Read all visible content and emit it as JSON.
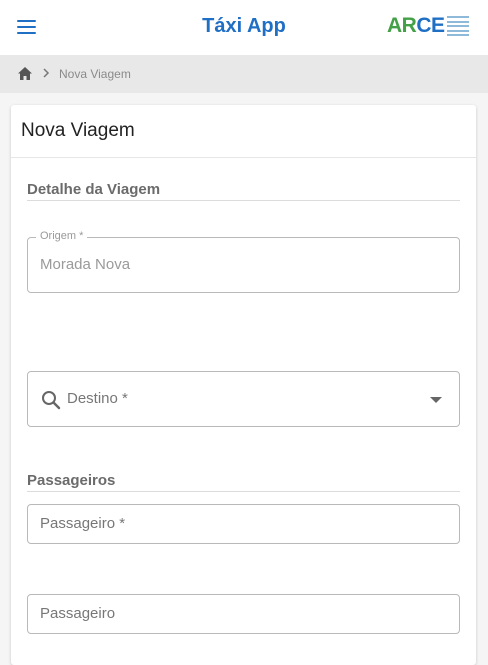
{
  "header": {
    "title": "Táxi App",
    "logo": {
      "part1": "AR",
      "part2": "CE",
      "primary_color": "#43a047",
      "secondary_color": "#1f6fc5"
    }
  },
  "breadcrumb": {
    "current": "Nova Viagem"
  },
  "card": {
    "title": "Nova Viagem",
    "trip_section": "Detalhe da Viagem",
    "origin": {
      "label": "Origem *",
      "value": "Morada Nova"
    },
    "destination": {
      "placeholder": "Destino *"
    },
    "passengers_section": "Passageiros",
    "passenger_1": {
      "placeholder": "Passageiro *"
    },
    "passenger_2": {
      "placeholder": "Passageiro"
    }
  },
  "colors": {
    "accent": "#1f6fc5",
    "page_background": "#f5f5f5",
    "breadcrumb_background": "#e8e8e8"
  }
}
